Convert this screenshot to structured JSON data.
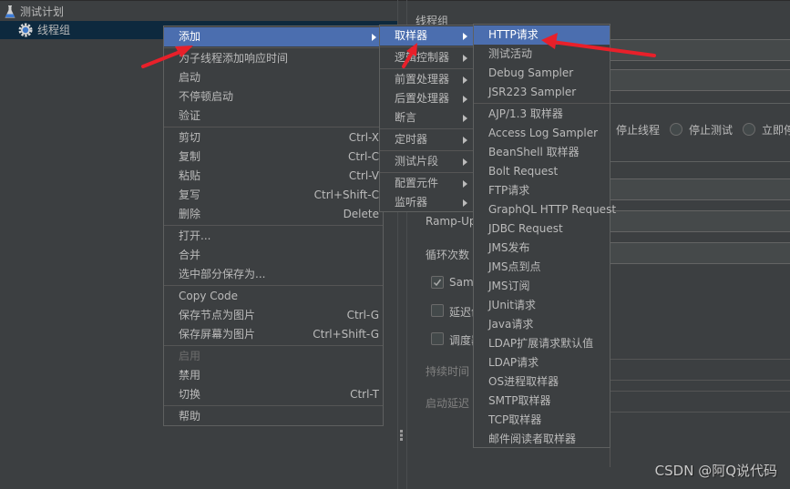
{
  "tree": {
    "items": [
      {
        "label": "测试计划",
        "icon": "flask-icon"
      },
      {
        "label": "线程组",
        "icon": "gear-icon",
        "selected": true
      }
    ]
  },
  "panel": {
    "title": "线程组",
    "error_action_options": [
      "停止线程",
      "停止测试",
      "立即停止测试"
    ],
    "labels": {
      "ramp_up": "Ramp-Up",
      "loop_count": "循环次数",
      "same_user": "Same user on each iteration",
      "delay_thread": "延迟创建线程直到需要",
      "scheduler": "调度器",
      "duration": "持续时间",
      "startup_delay": "启动延迟"
    },
    "same_user_checked": true,
    "delay_checked": false,
    "scheduler_checked": false
  },
  "context_menu": {
    "groups": [
      [
        {
          "label": "添加",
          "submenu": true,
          "active": true
        }
      ],
      [
        {
          "label": "为子线程添加响应时间"
        },
        {
          "label": "启动"
        },
        {
          "label": "不停顿启动"
        },
        {
          "label": "验证"
        }
      ],
      [
        {
          "label": "剪切",
          "shortcut": "Ctrl-X"
        },
        {
          "label": "复制",
          "shortcut": "Ctrl-C"
        },
        {
          "label": "粘贴",
          "shortcut": "Ctrl-V"
        },
        {
          "label": "复写",
          "shortcut": "Ctrl+Shift-C"
        },
        {
          "label": "删除",
          "shortcut": "Delete"
        }
      ],
      [
        {
          "label": "打开..."
        },
        {
          "label": "合并"
        },
        {
          "label": "选中部分保存为..."
        }
      ],
      [
        {
          "label": "Copy Code"
        },
        {
          "label": "保存节点为图片",
          "shortcut": "Ctrl-G"
        },
        {
          "label": "保存屏幕为图片",
          "shortcut": "Ctrl+Shift-G"
        }
      ],
      [
        {
          "label": "启用",
          "disabled": true
        },
        {
          "label": "禁用"
        },
        {
          "label": "切换",
          "shortcut": "Ctrl-T"
        }
      ],
      [
        {
          "label": "帮助"
        }
      ]
    ]
  },
  "add_submenu": {
    "groups": [
      [
        {
          "label": "取样器",
          "active": true
        }
      ],
      [
        {
          "label": "逻辑控制器"
        },
        {
          "label": "前置处理器"
        },
        {
          "label": "后置处理器"
        },
        {
          "label": "断言"
        }
      ],
      [
        {
          "label": "定时器"
        }
      ],
      [
        {
          "label": "测试片段"
        }
      ],
      [
        {
          "label": "配置元件"
        },
        {
          "label": "监听器"
        }
      ]
    ]
  },
  "sampler_submenu": {
    "groups": [
      [
        {
          "label": "HTTP请求",
          "active": true
        },
        {
          "label": "测试活动"
        },
        {
          "label": "Debug Sampler"
        },
        {
          "label": "JSR223 Sampler"
        }
      ],
      [
        {
          "label": "AJP/1.3 取样器"
        },
        {
          "label": "Access Log Sampler"
        },
        {
          "label": "BeanShell 取样器"
        },
        {
          "label": "Bolt Request"
        },
        {
          "label": "FTP请求"
        },
        {
          "label": "GraphQL HTTP Request"
        },
        {
          "label": "JDBC Request"
        },
        {
          "label": "JMS发布"
        },
        {
          "label": "JMS点到点"
        },
        {
          "label": "JMS订阅"
        },
        {
          "label": "JUnit请求"
        },
        {
          "label": "Java请求"
        },
        {
          "label": "LDAP扩展请求默认值"
        },
        {
          "label": "LDAP请求"
        },
        {
          "label": "OS进程取样器"
        },
        {
          "label": "SMTP取样器"
        },
        {
          "label": "TCP取样器"
        },
        {
          "label": "邮件阅读者取样器"
        }
      ]
    ]
  },
  "watermark": "CSDN @阿Q说代码",
  "colors": {
    "highlight": "#4b6eaf",
    "arrow": "#e8202a",
    "background": "#3c3f41"
  }
}
